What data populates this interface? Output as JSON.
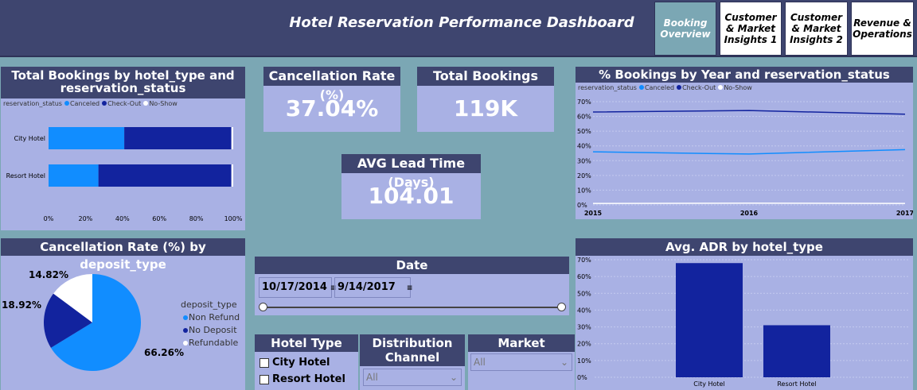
{
  "header": {
    "title": "Hotel Reservation Performance Dashboard",
    "nav": [
      {
        "label": "Booking Overview",
        "active": true
      },
      {
        "label": "Customer & Market Insights 1",
        "active": false
      },
      {
        "label": "Customer & Market Insights 2",
        "active": false
      },
      {
        "label": "Revenue & Operations",
        "active": false
      }
    ]
  },
  "kpis": {
    "cancellation_rate": {
      "title": "Cancellation Rate (%)",
      "value": "37.04%"
    },
    "total_bookings": {
      "title": "Total Bookings",
      "value": "119K"
    },
    "avg_lead_time": {
      "title": "AVG Lead Time (Days)",
      "value": "104.01"
    }
  },
  "bookings_by_type": {
    "title": "Total Bookings by hotel_type and reservation_status",
    "legend_title": "reservation_status",
    "legend": [
      "Canceled",
      "Check-Out",
      "No-Show"
    ],
    "colors": [
      "#118dff",
      "#12239e",
      "#ffffff"
    ],
    "categories": [
      "City Hotel",
      "Resort Hotel"
    ],
    "x_ticks": [
      "0%",
      "20%",
      "40%",
      "60%",
      "80%",
      "100%"
    ]
  },
  "pct_by_year": {
    "title": "% Bookings by Year and reservation_status",
    "legend_title": "reservation_status",
    "legend": [
      "Canceled",
      "Check-Out",
      "No-Show"
    ],
    "y_ticks": [
      "70%",
      "60%",
      "50%",
      "40%",
      "30%",
      "20%",
      "10%",
      "0%"
    ],
    "x_ticks": [
      "2015",
      "2016",
      "2017"
    ]
  },
  "deposit_pie": {
    "title": "Cancellation Rate (%) by deposit_type",
    "legend_title": "deposit_type",
    "labels": [
      "14.82%",
      "18.92%",
      "66.26%"
    ]
  },
  "date_slicer": {
    "title": "Date",
    "start": "10/17/2014",
    "end": "9/14/2017"
  },
  "hotel_type_slicer": {
    "title": "Hotel Type",
    "options": [
      "City Hotel",
      "Resort Hotel"
    ]
  },
  "distribution_slicer": {
    "title": "Distribution Channel",
    "value": "All"
  },
  "market_slicer": {
    "title": "Market Segment",
    "value": "All"
  },
  "adr_chart": {
    "title": "Avg. ADR by hotel_type",
    "y_ticks": [
      "70%",
      "60%",
      "50%",
      "40%",
      "30%",
      "20%",
      "10%",
      "0%"
    ]
  },
  "chart_data": [
    {
      "type": "bar",
      "orientation": "horizontal-stacked-100",
      "categories": [
        "City Hotel",
        "Resort Hotel"
      ],
      "series": [
        {
          "name": "Canceled",
          "values": [
            41,
            27
          ]
        },
        {
          "name": "Check-Out",
          "values": [
            58,
            72
          ]
        },
        {
          "name": "No-Show",
          "values": [
            1,
            1
          ]
        }
      ],
      "title": "Total Bookings by hotel_type and reservation_status",
      "xlim": [
        0,
        100
      ]
    },
    {
      "type": "line",
      "x": [
        "2015",
        "2016",
        "2017"
      ],
      "series": [
        {
          "name": "Canceled",
          "values": [
            36,
            34.5,
            37.5
          ]
        },
        {
          "name": "Check-Out",
          "values": [
            63,
            64,
            61.5
          ]
        },
        {
          "name": "No-Show",
          "values": [
            1,
            1.2,
            1
          ]
        }
      ],
      "title": "% Bookings by Year and reservation_status",
      "ylim": [
        0,
        70
      ]
    },
    {
      "type": "pie",
      "categories": [
        "Non Refund",
        "No Deposit",
        "Refundable"
      ],
      "values": [
        66.26,
        18.92,
        14.82
      ],
      "colors": [
        "#118dff",
        "#12239e",
        "#ffffff"
      ],
      "title": "Cancellation Rate (%) by deposit_type"
    },
    {
      "type": "bar",
      "categories": [
        "City Hotel",
        "Resort Hotel"
      ],
      "values": [
        68,
        31
      ],
      "title": "Avg. ADR by hotel_type",
      "ylim": [
        0,
        70
      ]
    }
  ]
}
